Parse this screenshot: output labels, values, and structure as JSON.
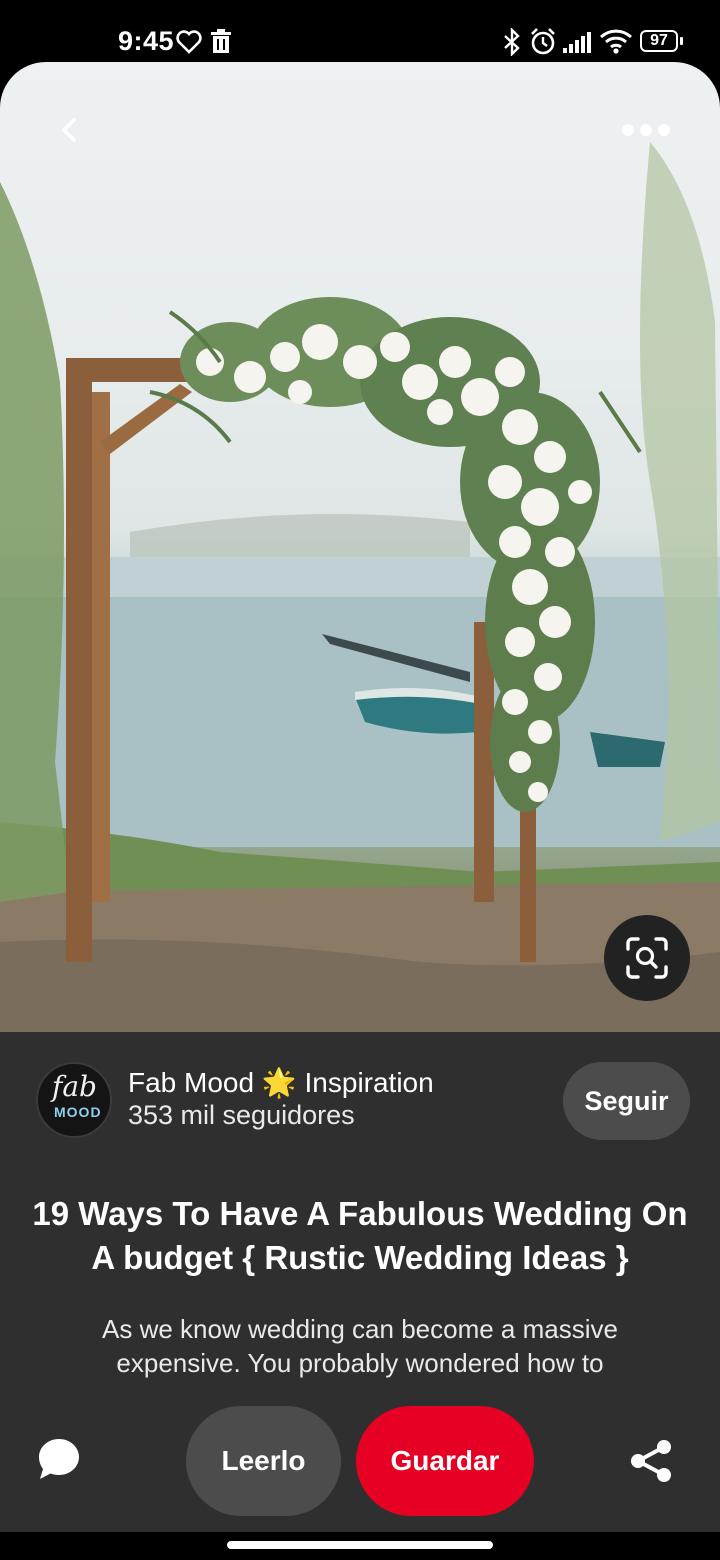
{
  "status_bar": {
    "time": "9:45",
    "battery": "97",
    "icons": [
      "heart-outline-icon",
      "trash-icon",
      "bluetooth-icon",
      "alarm-icon",
      "signal-icon",
      "wifi-icon",
      "battery-icon"
    ]
  },
  "hero": {
    "icons": [
      "back-chevron-icon",
      "more-dots-icon",
      "visual-search-icon"
    ]
  },
  "creator": {
    "avatar_text_top": "fab",
    "avatar_text_bottom": "MOOD",
    "name_part1": "Fab Mood",
    "name_emoji": "🌟",
    "name_part2": "Inspiration",
    "followers": "353 mil seguidores",
    "follow_label": "Seguir"
  },
  "pin": {
    "title": "19 Ways To Have A Fabulous Wedding On A budget { Rustic Wedding Ideas }",
    "description": "As we know wedding can become a massive expensive. You probably wondered how to"
  },
  "actions": {
    "read_label": "Leerlo",
    "save_label": "Guardar",
    "icons": [
      "comment-icon",
      "share-icon"
    ]
  },
  "colors": {
    "panel": "#2f2f2f",
    "save_button": "#e60023",
    "secondary_button": "#4c4c4c"
  }
}
